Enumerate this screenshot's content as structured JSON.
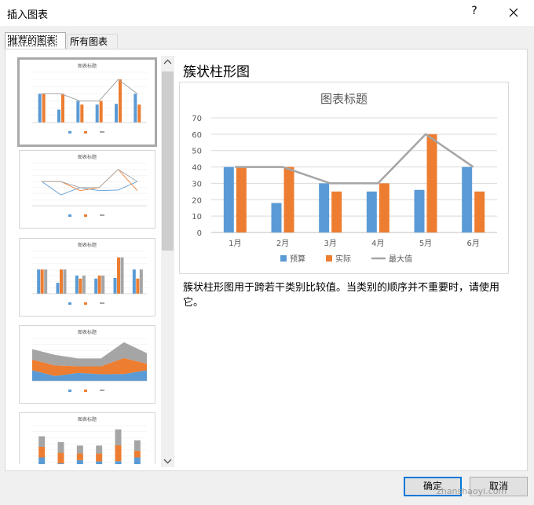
{
  "window": {
    "title": "插入图表",
    "help_label": "?",
    "close_icon": "close-icon"
  },
  "tabs": [
    {
      "label": "推荐的图表"
    },
    {
      "label": "所有图表"
    }
  ],
  "preview": {
    "title": "簇状柱形图",
    "description": "簇状柱形图用于跨若干类别比较值。当类别的顺序并不重要时，请使用它。"
  },
  "thumbnails": [
    {
      "kind": "clustered-column-line",
      "title": "图表标题"
    },
    {
      "kind": "line",
      "title": "图表标题"
    },
    {
      "kind": "clustered-column",
      "title": "图表标题"
    },
    {
      "kind": "stacked-area",
      "title": "图表标题"
    },
    {
      "kind": "stacked-column",
      "title": "图表标题"
    }
  ],
  "buttons": {
    "ok": "确定",
    "cancel": "取消"
  },
  "watermark": "zhanshaoyi.com",
  "colors": {
    "budget": "#5b9bd5",
    "actual": "#ed7d31",
    "max": "#a5a5a5",
    "accent": "#0078d7"
  },
  "chart_data": {
    "type": "bar",
    "title": "图表标题",
    "categories": [
      "1月",
      "2月",
      "3月",
      "4月",
      "5月",
      "6月"
    ],
    "series": [
      {
        "name": "预算",
        "type": "bar",
        "values": [
          40,
          18,
          30,
          25,
          26,
          40
        ]
      },
      {
        "name": "实际",
        "type": "bar",
        "values": [
          40,
          40,
          25,
          30,
          60,
          25
        ]
      },
      {
        "name": "最大值",
        "type": "line",
        "values": [
          40,
          40,
          30,
          30,
          60,
          40
        ]
      }
    ],
    "yticks": [
      0,
      10,
      20,
      30,
      40,
      50,
      60,
      70
    ],
    "ylim": [
      0,
      70
    ],
    "grid": true,
    "legend": "bottom"
  }
}
